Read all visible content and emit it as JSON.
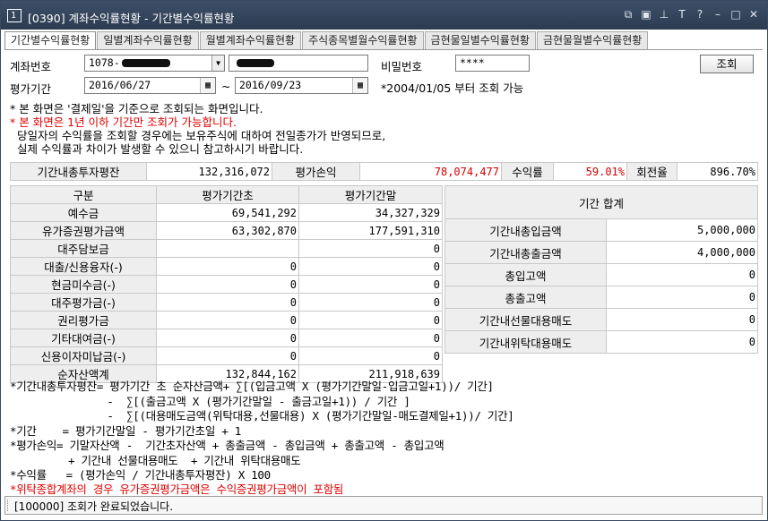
{
  "window": {
    "number": "1",
    "title": "[0390] 계좌수익률현황 - 기간별수익률현황",
    "controls": [
      "restore-icon",
      "window-icon",
      "pin-icon",
      "font-icon",
      "help-icon",
      "minimize-icon",
      "maximize-icon",
      "close-icon"
    ]
  },
  "tabs": [
    {
      "label": "기간별수익률현황",
      "active": true
    },
    {
      "label": "일별계좌수익률현황",
      "active": false
    },
    {
      "label": "월별계좌수익률현황",
      "active": false
    },
    {
      "label": "주식종목별월수익률현황",
      "active": false
    },
    {
      "label": "금현물일별수익률현황",
      "active": false
    },
    {
      "label": "금현물월별수익률현황",
      "active": false
    }
  ],
  "form": {
    "account_label": "계좌번호",
    "account_value": "1078-",
    "password_label": "비밀번호",
    "password_value": "****",
    "query_button": "조회",
    "period_label": "평가기간",
    "start_date": "2016/06/27",
    "tilde": "~",
    "end_date": "2016/09/23",
    "period_note": "*2004/01/05 부터 조회 가능"
  },
  "notes": {
    "line1": "* 본 화면은 '결제일'을 기준으로 조회되는 화면입니다.",
    "line2": "* 본 화면은 1년 이하 기간만 조회가 가능합니다.",
    "line3": "  당일자의 수익률을 조회할 경우에는 보유주식에 대하여 전일종가가 반영되므로,",
    "line4": "  실제 수익률과 차이가 발생할 수 있으니 참고하시기 바랍니다."
  },
  "summary": {
    "invest_label": "기간내총투자평잔",
    "invest_value": "132,316,072",
    "pnl_label": "평가손익",
    "pnl_value": "78,074,477",
    "return_label": "수익률",
    "return_value": "59.01%",
    "turnover_label": "회전율",
    "turnover_value": "896.70%"
  },
  "left_table": {
    "headers": [
      "구분",
      "평가기간초",
      "평가기간말"
    ],
    "rows": [
      {
        "label": "예수금",
        "start": "69,541,292",
        "end": "34,327,329"
      },
      {
        "label": "유가증권평가금액",
        "start": "63,302,870",
        "end": "177,591,310"
      },
      {
        "label": "대주담보금",
        "start": "",
        "end": "0"
      },
      {
        "label": "대출/신용융자(-)",
        "start": "0",
        "end": "0"
      },
      {
        "label": "현금미수금(-)",
        "start": "0",
        "end": "0"
      },
      {
        "label": "대주평가금(-)",
        "start": "0",
        "end": "0"
      },
      {
        "label": "권리평가금",
        "start": "0",
        "end": "0"
      },
      {
        "label": "기타대여금(-)",
        "start": "0",
        "end": "0"
      },
      {
        "label": "신용이자미납금(-)",
        "start": "0",
        "end": "0"
      }
    ],
    "total": {
      "label": "순자산액계",
      "start": "132,844,162",
      "end": "211,918,639"
    }
  },
  "right_table": {
    "header": "기간 합계",
    "rows": [
      {
        "label": "기간내총입금액",
        "value": "5,000,000"
      },
      {
        "label": "기간내총출금액",
        "value": "4,000,000"
      },
      {
        "label": "총입고액",
        "value": "0"
      },
      {
        "label": "총출고액",
        "value": "0"
      },
      {
        "label": "기간내선물대용매도",
        "value": "0"
      },
      {
        "label": "기간내위탁대용매도",
        "value": "0"
      }
    ]
  },
  "formulas": {
    "f1": "*기간내총투자평잔= 평가기간 초 순자산금액+ ∑[(입금고액 X (평가기간말일-입금고일+1))/ 기간]",
    "f2": "               -  ∑[(출금고액 X (평가기간말일 - 출금고일+1)) / 기간 ]",
    "f3": "               -  ∑[(대용매도금액(위탁대용,선물대용) X (평가기간말일-매도결제일+1))/ 기간]",
    "f4": "*기간    = 평가기간말일 - 평가기간초일 + 1",
    "f5": "*평가손익= 기말자산액 -  기간초자산액 + 총출금액 - 총입금액 + 총출고액 - 총입고액",
    "f6": "         + 기간내 선물대용매도  + 기간내 위탁대용매도",
    "f7": "*수익률   = (평가손익 / 기간내총투자평잔) X 100",
    "f8": "*위탁종합계좌의 경우 유가증권평가금액은 수익증권평가금액이 포함됨"
  },
  "status": {
    "message": "[100000] 조회가 완료되었습니다."
  },
  "colors": {
    "titlebar": "#33445b",
    "warning_red": "#e00000",
    "header_gray": "#eeeeee"
  }
}
